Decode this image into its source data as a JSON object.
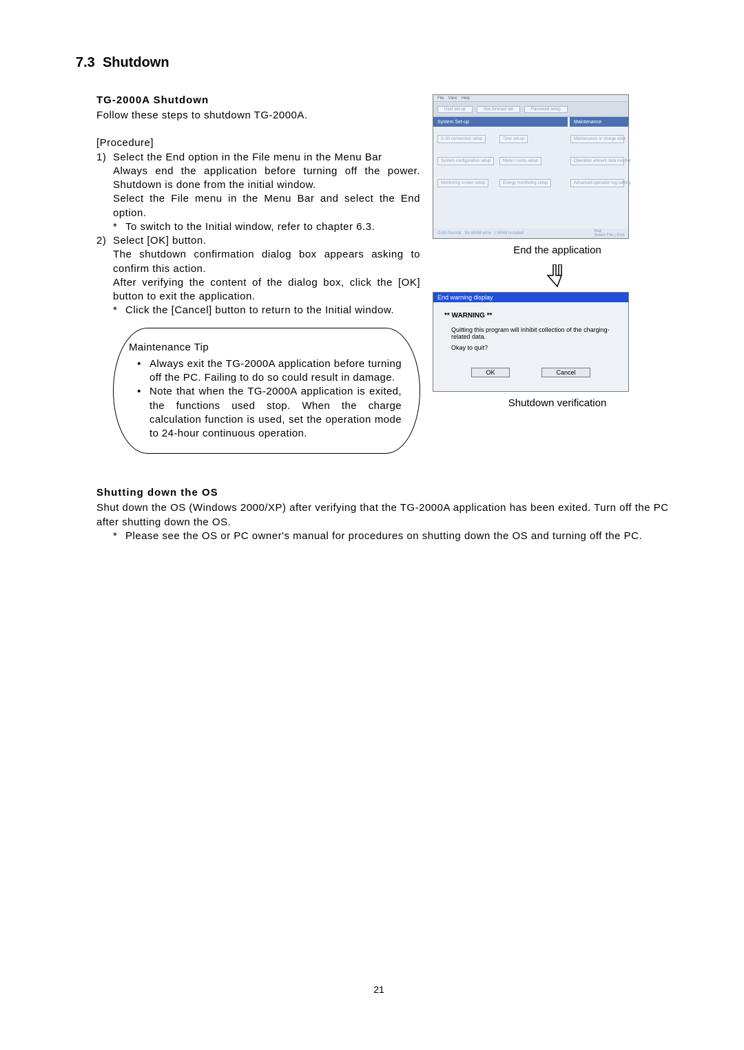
{
  "section": {
    "number": "7.3",
    "title": "Shutdown"
  },
  "tg2000a": {
    "heading": "TG-2000A Shutdown",
    "intro": "Follow these steps to shutdown TG-2000A.",
    "procedure_label": "[Procedure]",
    "step1_num": "1)",
    "step1_title": "Select the End option in the File menu in the Menu Bar",
    "step1_body1": "Always end the application before turning off the power. Shutdown is done from the initial window.",
    "step1_body2": "Select the File menu in the Menu Bar and select the End option.",
    "step1_note_star": "*",
    "step1_note": "To switch to the Initial window, refer to chapter 6.3.",
    "step2_num": "2)",
    "step2_title": "Select [OK] button.",
    "step2_body1": "The shutdown confirmation dialog box appears asking to confirm this action.",
    "step2_body2": "After verifying the content of the dialog box, click the [OK] button to exit the application.",
    "step2_note_star": "*",
    "step2_note": "Click the [Cancel] button to return to the Initial window."
  },
  "tip": {
    "title": "Maintenance Tip",
    "bullet": "•",
    "item1": "Always exit the TG-2000A application before turning off the PC. Failing to do so could result in damage.",
    "item2": "Note that when the TG-2000A application is exited, the functions used stop. When the charge calculation function is used, set the operation mode to 24-hour continuous operation."
  },
  "os": {
    "heading": "Shutting down the OS",
    "line1": "Shut down the OS (Windows 2000/XP) after verifying that the TG-2000A application has been exited. Turn off the PC after shutting down the OS.",
    "note_star": "*",
    "note": "Please see the OS or PC owner's manual for procedures on shutting down the OS and turning off the PC."
  },
  "fig1": {
    "menubar": [
      "File",
      "View",
      "Help"
    ],
    "toolbar_buttons": [
      "User set-up",
      "Site forecast set",
      "Password setup"
    ],
    "section_left": "System Set-up",
    "section_right": "Maintenance",
    "cells_left": [
      "G-50 connection setup",
      "Time set-up",
      "System configuration setup",
      "Meter / costs setup",
      "Monitoring screen setup",
      "Energy monitoring setup"
    ],
    "cells_right": [
      "Maintenance or charge data",
      "Operation amount data monitor",
      "Advanced operation log setting"
    ],
    "status_left": [
      "G-50 Normal",
      "No WHM error",
      "| WHM Installed"
    ],
    "status_right1": "Mail",
    "status_right2": "Select File | End",
    "caption": "End the application"
  },
  "fig2": {
    "titlebar": "End warning display",
    "warning": "** WARNING **",
    "msg1": "Quitting this program will inhibit collection of the charging-related data.",
    "msg2": "Okay to quit?",
    "ok": "OK",
    "cancel": "Cancel",
    "caption": "Shutdown verification"
  },
  "page_number": "21"
}
